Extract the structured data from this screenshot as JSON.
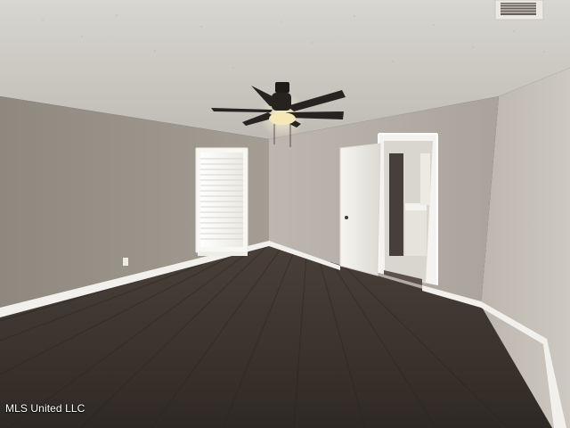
{
  "photo": {
    "watermark": "MLS United LLC",
    "colors": {
      "ceiling": "#d2d0cb",
      "wall_left": "#928b82",
      "wall_back": "#b3ada5",
      "wall_right": "#c4bfb8",
      "floor": "#3d332d",
      "baseboard": "#f2f2ef",
      "fan_blade": "#272321",
      "fan_light": "#f6e7b9",
      "door": "#efeeea",
      "window_light": "#fbfbf6"
    },
    "icons": [
      "ceiling-fan-icon",
      "window-blinds-icon",
      "door-icon",
      "air-vent-icon"
    ]
  }
}
